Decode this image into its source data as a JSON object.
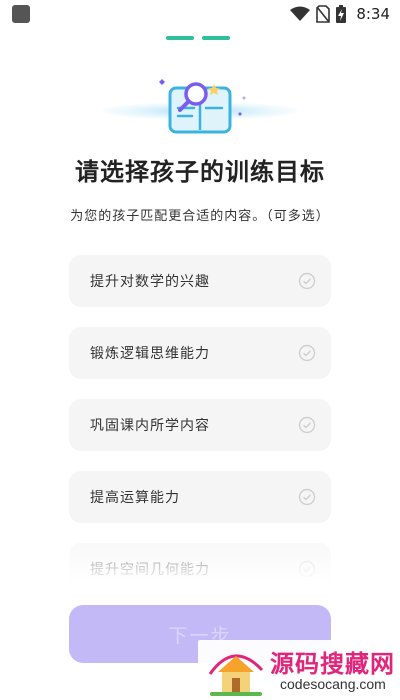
{
  "status_bar": {
    "time": "8:34",
    "icons": [
      "app-notification-icon",
      "wifi-icon",
      "no-sim-icon",
      "battery-charging-icon"
    ]
  },
  "pager": {
    "dots": 2,
    "accent": "#2fbf9d"
  },
  "hero": {
    "icon": "book-magnifier-illustration",
    "accent": "#3bb3e0"
  },
  "title": "请选择孩子的训练目标",
  "subtitle": "为您的孩子匹配更合适的内容。（可多选）",
  "options": [
    {
      "label": "提升对数学的兴趣",
      "selected": false
    },
    {
      "label": "锻炼逻辑思维能力",
      "selected": false
    },
    {
      "label": "巩固课内所学内容",
      "selected": false
    },
    {
      "label": "提高运算能力",
      "selected": false
    },
    {
      "label": "提升空间几何能力",
      "selected": false
    }
  ],
  "next_button": {
    "label": "下一步",
    "enabled": false,
    "color": "#c4b9f7"
  },
  "watermark": {
    "title": "源码搜藏网",
    "url": "codesocang.com"
  }
}
